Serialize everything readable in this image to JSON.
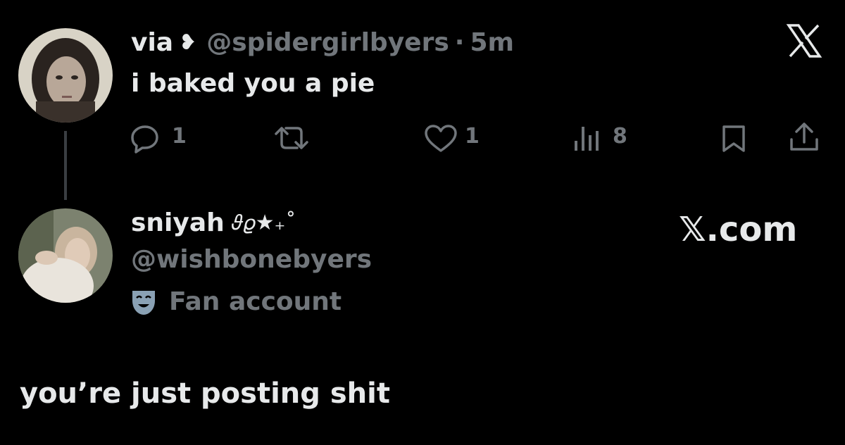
{
  "tweet": {
    "author_name": "via",
    "author_emoji": "❥",
    "handle": "@spidergirlbyers",
    "separator": "·",
    "time": "5m",
    "text": "i baked you a pie",
    "actions": {
      "reply_count": "1",
      "like_count": "1",
      "view_count": "8"
    },
    "close_icon": "x-logo-icon"
  },
  "reply_author": {
    "name": "sniyah",
    "name_decoration": "𝜗𝜚★₊˚",
    "handle": "@wishbonebyers",
    "badge_label": "Fan account",
    "badge_icon": "theater-mask-icon"
  },
  "watermark": "𝕏.com",
  "caption": "you’re just posting shit",
  "colors": {
    "background": "#000000",
    "text": "#e7e9ea",
    "muted": "#71767b",
    "badge": "#8aa1b4"
  }
}
